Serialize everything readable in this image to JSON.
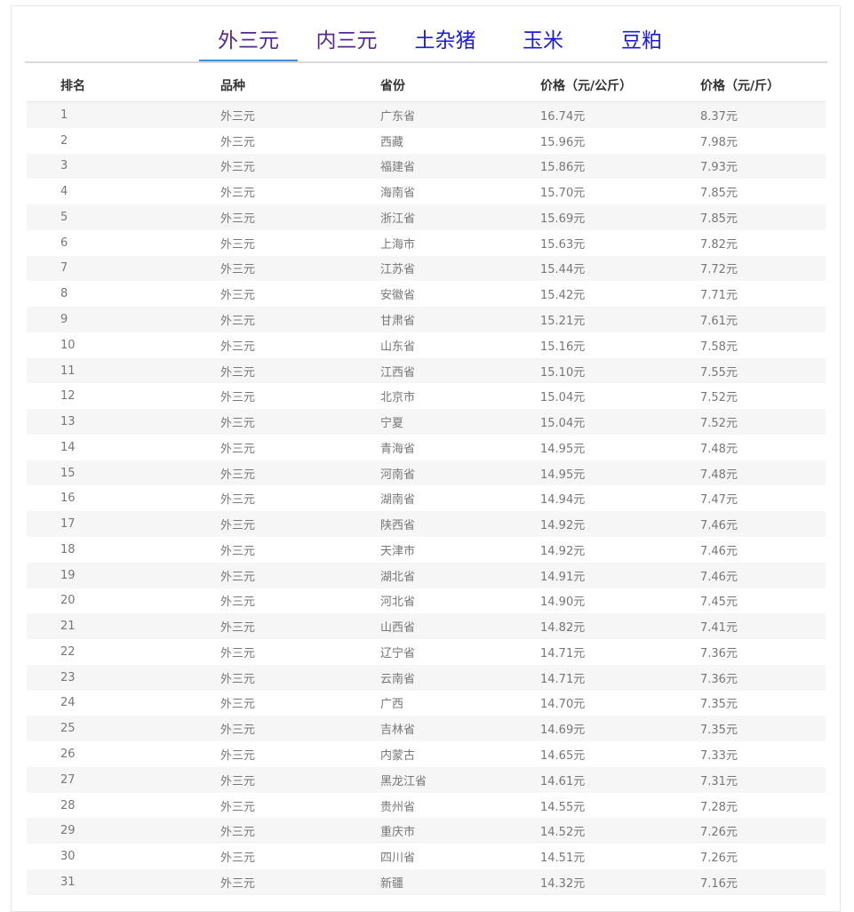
{
  "tabs": [
    {
      "label": "外三元",
      "active": true
    },
    {
      "label": "内三元",
      "active": false
    },
    {
      "label": "土杂猪",
      "active": false
    },
    {
      "label": "玉米",
      "active": false
    },
    {
      "label": "豆粕",
      "active": false
    }
  ],
  "colors": {
    "tab_active_underline": "#3a90dc",
    "tab_visited": "#55288f",
    "tab_link": "#1a1ae0",
    "row_stripe": "#f6f6f6"
  },
  "table": {
    "headers": [
      "排名",
      "品种",
      "省份",
      "价格（元/公斤）",
      "价格（元/斤）"
    ],
    "rows": [
      [
        "1",
        "外三元",
        "广东省",
        "16.74元",
        "8.37元"
      ],
      [
        "2",
        "外三元",
        "西藏",
        "15.96元",
        "7.98元"
      ],
      [
        "3",
        "外三元",
        "福建省",
        "15.86元",
        "7.93元"
      ],
      [
        "4",
        "外三元",
        "海南省",
        "15.70元",
        "7.85元"
      ],
      [
        "5",
        "外三元",
        "浙江省",
        "15.69元",
        "7.85元"
      ],
      [
        "6",
        "外三元",
        "上海市",
        "15.63元",
        "7.82元"
      ],
      [
        "7",
        "外三元",
        "江苏省",
        "15.44元",
        "7.72元"
      ],
      [
        "8",
        "外三元",
        "安徽省",
        "15.42元",
        "7.71元"
      ],
      [
        "9",
        "外三元",
        "甘肃省",
        "15.21元",
        "7.61元"
      ],
      [
        "10",
        "外三元",
        "山东省",
        "15.16元",
        "7.58元"
      ],
      [
        "11",
        "外三元",
        "江西省",
        "15.10元",
        "7.55元"
      ],
      [
        "12",
        "外三元",
        "北京市",
        "15.04元",
        "7.52元"
      ],
      [
        "13",
        "外三元",
        "宁夏",
        "15.04元",
        "7.52元"
      ],
      [
        "14",
        "外三元",
        "青海省",
        "14.95元",
        "7.48元"
      ],
      [
        "15",
        "外三元",
        "河南省",
        "14.95元",
        "7.48元"
      ],
      [
        "16",
        "外三元",
        "湖南省",
        "14.94元",
        "7.47元"
      ],
      [
        "17",
        "外三元",
        "陕西省",
        "14.92元",
        "7.46元"
      ],
      [
        "18",
        "外三元",
        "天津市",
        "14.92元",
        "7.46元"
      ],
      [
        "19",
        "外三元",
        "湖北省",
        "14.91元",
        "7.46元"
      ],
      [
        "20",
        "外三元",
        "河北省",
        "14.90元",
        "7.45元"
      ],
      [
        "21",
        "外三元",
        "山西省",
        "14.82元",
        "7.41元"
      ],
      [
        "22",
        "外三元",
        "辽宁省",
        "14.71元",
        "7.36元"
      ],
      [
        "23",
        "外三元",
        "云南省",
        "14.71元",
        "7.36元"
      ],
      [
        "24",
        "外三元",
        "广西",
        "14.70元",
        "7.35元"
      ],
      [
        "25",
        "外三元",
        "吉林省",
        "14.69元",
        "7.35元"
      ],
      [
        "26",
        "外三元",
        "内蒙古",
        "14.65元",
        "7.33元"
      ],
      [
        "27",
        "外三元",
        "黑龙江省",
        "14.61元",
        "7.31元"
      ],
      [
        "28",
        "外三元",
        "贵州省",
        "14.55元",
        "7.28元"
      ],
      [
        "29",
        "外三元",
        "重庆市",
        "14.52元",
        "7.26元"
      ],
      [
        "30",
        "外三元",
        "四川省",
        "14.51元",
        "7.26元"
      ],
      [
        "31",
        "外三元",
        "新疆",
        "14.32元",
        "7.16元"
      ]
    ]
  }
}
